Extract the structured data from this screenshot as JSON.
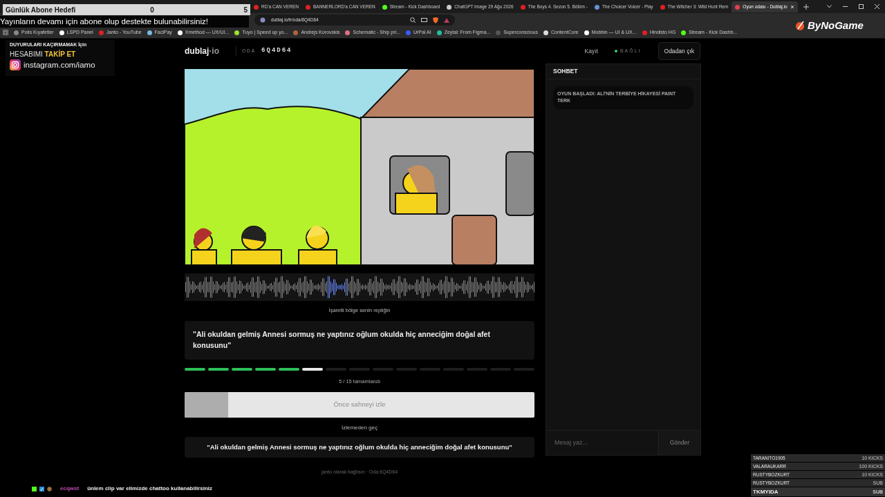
{
  "browser": {
    "tabs": [
      {
        "title": "RD'a CAN VEREN",
        "color": "#e02020",
        "selected": false
      },
      {
        "title": "BANNERLORD'a CAN VEREN",
        "color": "#e02020",
        "selected": false
      },
      {
        "title": "Stream - Kick Dashboard",
        "color": "#53fc18",
        "selected": false
      },
      {
        "title": "ChatGPT Image 29 Ağu 2026",
        "color": "#cccccc",
        "selected": false
      },
      {
        "title": "The Boys 4. Sezon 5. Bölüm -",
        "color": "#e02020",
        "selected": false
      },
      {
        "title": "The Choicer Voicer - Play",
        "color": "#6a8fd8",
        "selected": false
      },
      {
        "title": "The Witcher 3: Wild Hunt Rem",
        "color": "#e02020",
        "selected": false
      },
      {
        "title": "Oyun odası - Dublaj.io",
        "color": "#e04050",
        "selected": true
      }
    ],
    "address": "dublaj.io/tr/oda/6Q4D64",
    "bookmarks": [
      {
        "title": "Polis Kıyafetler",
        "color": "#888888"
      },
      {
        "title": "LSPD Panel",
        "color": "#ffffff"
      },
      {
        "title": "Janto - YouTube",
        "color": "#e02020"
      },
      {
        "title": "FaciPay",
        "color": "#7ab8e0"
      },
      {
        "title": "Xmethod — UX/UI...",
        "color": "#ffffff"
      },
      {
        "title": "Tuyo | Speed up yo...",
        "color": "#9be22d"
      },
      {
        "title": "Andrejs Korovskis",
        "color": "#b0643c"
      },
      {
        "title": "Schematic - Ship pri...",
        "color": "#e07080"
      },
      {
        "title": "UrPal AI",
        "color": "#3a5cff"
      },
      {
        "title": "Zeytal: From Figma...",
        "color": "#20c0a0"
      },
      {
        "title": "Superconscious",
        "color": "#555555"
      },
      {
        "title": "ContentCore",
        "color": "#dddddd"
      },
      {
        "title": "Mobbin — UI & UX...",
        "color": "#ffffff"
      },
      {
        "title": "Hindisto HG",
        "color": "#e02020"
      },
      {
        "title": "Stream - Kick Dashb...",
        "color": "#53fc18"
      }
    ]
  },
  "app": {
    "logo": {
      "name": "dublaj",
      "separator": "·",
      "suffix": "io"
    },
    "room_label": "ODA",
    "room_code": "6Q4D64",
    "nav": {
      "register": "Kayıt",
      "status": "BAĞLI",
      "connected": true,
      "leave": "Odadan çık"
    },
    "caption": "İşaretli bölge senin repliğin",
    "line": "\"Ali okuldan gelmiş Annesi sormuş ne yaptınız oğlum okulda hiç anneciğim doğal afet konusunu\"",
    "progress": {
      "segments": [
        {
          "kind": "done"
        },
        {
          "kind": "done"
        },
        {
          "kind": "done"
        },
        {
          "kind": "done"
        },
        {
          "kind": "done"
        },
        {
          "kind": "current"
        },
        {
          "kind": "pending"
        },
        {
          "kind": "pending"
        },
        {
          "kind": "pending"
        },
        {
          "kind": "pending"
        },
        {
          "kind": "pending"
        },
        {
          "kind": "pending"
        },
        {
          "kind": "pending"
        },
        {
          "kind": "pending"
        },
        {
          "kind": "pending"
        }
      ],
      "text": "5 / 15 tamamlandı"
    },
    "watch_button": {
      "label": "Önce sahneyi izle",
      "disabled": true,
      "level": 0.125
    },
    "skip": "İzlemeden geç",
    "subtitle": "\"Ali okuldan gelmiş Annesi sormuş ne yaptınız oğlum okulda hiç anneciğim doğal afet konusunu\"",
    "footer": "janto olarak bağlısın · Oda 6Q4D64"
  },
  "chat": {
    "title": "SOHBET",
    "messages": [
      "OYUN BAŞLADI: ALİ'NİN TERBİYE HİKAYESİ PAINT TERK"
    ],
    "input": {
      "placeholder": "Mesaj yaz..."
    },
    "send": "Gönder"
  },
  "stream_overlay": {
    "goal": {
      "label": "Günlük Abone Hedefi",
      "current": "0",
      "target": "5"
    },
    "notice": "Yayınların devamı için abone olup destekte bulunabilirsiniz!",
    "social": {
      "small": "DUYURULARI KAÇIRMAMAK İçin",
      "lead": "HESABIMI",
      "accent": "TAKİP ET",
      "handle": "instagram.com/iamo"
    },
    "brand": "ByNoGame",
    "chat_line": {
      "user": "ecqwst",
      "text": "ünlem clip var elimizde chattoo kullanabilirsiniz"
    },
    "events": [
      {
        "name": "TARANITO1905",
        "label": "10 KICKS"
      },
      {
        "name": "VALARAUKARR",
        "label": "100 KICKS"
      },
      {
        "name": "RUSTYBOZKURT",
        "label": "10 KICKS"
      },
      {
        "name": "RUSTYBOZKURT",
        "label": "SUB"
      },
      {
        "name": "TKMYIDA",
        "label": "SUB"
      }
    ]
  }
}
